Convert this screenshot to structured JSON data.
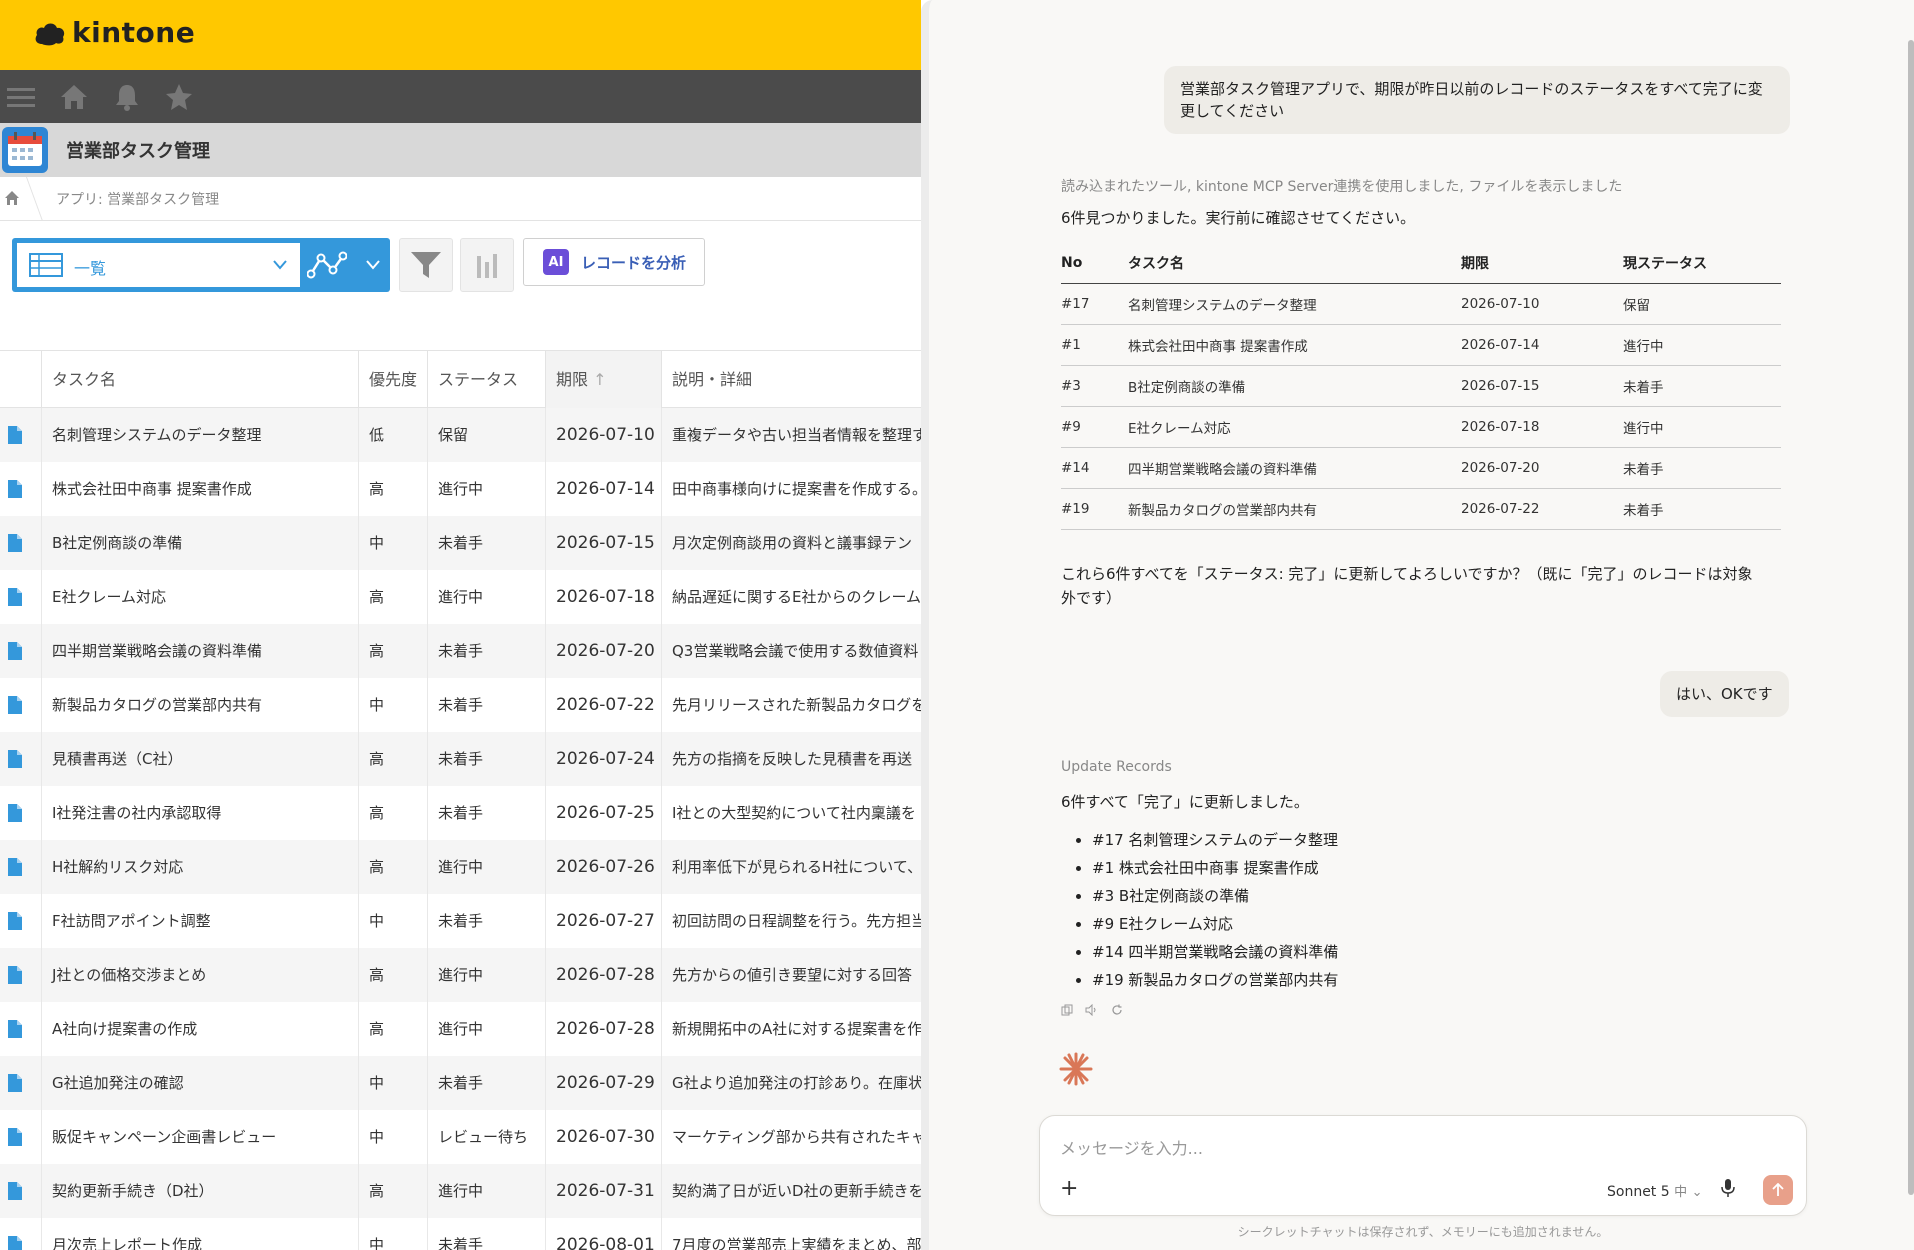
{
  "kintone": {
    "logo_text": "kintone",
    "app_title": "営業部タスク管理",
    "breadcrumb": "アプリ: 営業部タスク管理",
    "view_label": "一覧",
    "ai_badge": "AI",
    "analyze_label": "レコードを分析",
    "columns": {
      "task": "タスク名",
      "priority": "優先度",
      "status": "ステータス",
      "due": "期限",
      "due_sort": "↑",
      "desc": "説明・詳細"
    },
    "rows": [
      {
        "task": "名刺管理システムのデータ整理",
        "priority": "低",
        "status": "保留",
        "due": "2026-07-10",
        "desc": "重複データや古い担当者情報を整理す"
      },
      {
        "task": "株式会社田中商事 提案書作成",
        "priority": "高",
        "status": "進行中",
        "due": "2026-07-14",
        "desc": "田中商事様向けに提案書を作成する。"
      },
      {
        "task": "B社定例商談の準備",
        "priority": "中",
        "status": "未着手",
        "due": "2026-07-15",
        "desc": "月次定例商談用の資料と議事録テン"
      },
      {
        "task": "E社クレーム対応",
        "priority": "高",
        "status": "進行中",
        "due": "2026-07-18",
        "desc": "納品遅延に関するE社からのクレーム"
      },
      {
        "task": "四半期営業戦略会議の資料準備",
        "priority": "高",
        "status": "未着手",
        "due": "2026-07-20",
        "desc": "Q3営業戦略会議で使用する数値資料"
      },
      {
        "task": "新製品カタログの営業部内共有",
        "priority": "中",
        "status": "未着手",
        "due": "2026-07-22",
        "desc": "先月リリースされた新製品カタログを"
      },
      {
        "task": "見積書再送（C社）",
        "priority": "高",
        "status": "未着手",
        "due": "2026-07-24",
        "desc": "先方の指摘を反映した見積書を再送"
      },
      {
        "task": "I社発注書の社内承認取得",
        "priority": "高",
        "status": "未着手",
        "due": "2026-07-25",
        "desc": "I社との大型契約について社内稟議を"
      },
      {
        "task": "H社解約リスク対応",
        "priority": "高",
        "status": "進行中",
        "due": "2026-07-26",
        "desc": "利用率低下が見られるH社について、"
      },
      {
        "task": "F社訪問アポイント調整",
        "priority": "中",
        "status": "未着手",
        "due": "2026-07-27",
        "desc": "初回訪問の日程調整を行う。先方担当"
      },
      {
        "task": "J社との価格交渉まとめ",
        "priority": "高",
        "status": "進行中",
        "due": "2026-07-28",
        "desc": "先方からの値引き要望に対する回答"
      },
      {
        "task": "A社向け提案書の作成",
        "priority": "高",
        "status": "進行中",
        "due": "2026-07-28",
        "desc": "新規開拓中のA社に対する提案書を作"
      },
      {
        "task": "G社追加発注の確認",
        "priority": "中",
        "status": "未着手",
        "due": "2026-07-29",
        "desc": "G社より追加発注の打診あり。在庫状"
      },
      {
        "task": "販促キャンペーン企画書レビュー",
        "priority": "中",
        "status": "レビュー待ち",
        "due": "2026-07-30",
        "desc": "マーケティング部から共有されたキャ"
      },
      {
        "task": "契約更新手続き（D社）",
        "priority": "高",
        "status": "進行中",
        "due": "2026-07-31",
        "desc": "契約満了日が近いD社の更新手続きを"
      },
      {
        "task": "月次売上レポート作成",
        "priority": "中",
        "status": "未着手",
        "due": "2026-08-01",
        "desc": "7月度の営業部売上実績をまとめ、部"
      }
    ]
  },
  "chat": {
    "user_message_1": "営業部タスク管理アプリで、期限が昨日以前のレコードのステータスをすべて完了に変更してください",
    "tools_used": "読み込まれたツール, kintone MCP Server連携を使用しました, ファイルを表示しました",
    "found_text": "6件見つかりました。実行前に確認させてください。",
    "table_headers": {
      "no": "No",
      "task": "タスク名",
      "due": "期限",
      "status": "現ステータス"
    },
    "table_rows": [
      {
        "no": "#17",
        "task": "名刺管理システムのデータ整理",
        "due": "2026-07-10",
        "status": "保留"
      },
      {
        "no": "#1",
        "task": "株式会社田中商事 提案書作成",
        "due": "2026-07-14",
        "status": "進行中"
      },
      {
        "no": "#3",
        "task": "B社定例商談の準備",
        "due": "2026-07-15",
        "status": "未着手"
      },
      {
        "no": "#9",
        "task": "E社クレーム対応",
        "due": "2026-07-18",
        "status": "進行中"
      },
      {
        "no": "#14",
        "task": "四半期営業戦略会議の資料準備",
        "due": "2026-07-20",
        "status": "未着手"
      },
      {
        "no": "#19",
        "task": "新製品カタログの営業部内共有",
        "due": "2026-07-22",
        "status": "未着手"
      }
    ],
    "confirm_text": "これら6件すべてを「ステータス: 完了」に更新してよろしいですか？（既に「完了」のレコードは対象外です）",
    "user_message_2": "はい、OKです",
    "tool_label": "Update Records",
    "result_text": "6件すべて「完了」に更新しました。",
    "updated_items": [
      "#17 名刺管理システムのデータ整理",
      "#1 株式会社田中商事 提案書作成",
      "#3 B社定例商談の準備",
      "#9 E社クレーム対応",
      "#14 四半期営業戦略会議の資料準備",
      "#19 新製品カタログの営業部内共有"
    ],
    "input_placeholder": "メッセージを入力...",
    "model_name": "Sonnet 5",
    "model_effort": "中",
    "footer_note": "シークレットチャットは保存されず、メモリーにも追加されません。"
  },
  "colors": {
    "kintone_yellow": "#ffc800",
    "kintone_blue": "#3498db",
    "nav_dark": "#4b4b4b",
    "send_button": "#e8a08a",
    "claude_orange": "#d97757"
  }
}
